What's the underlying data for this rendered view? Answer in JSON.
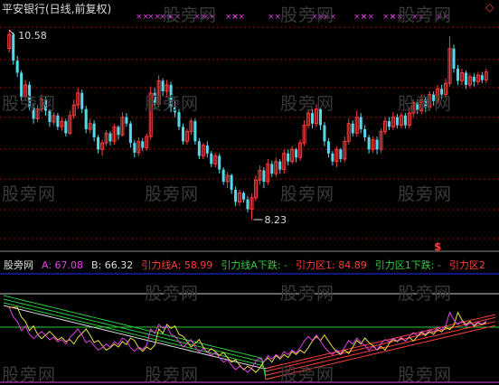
{
  "title": "平安银行(日线,前复权)",
  "colors": {
    "up": "#ff3b3b",
    "down": "#57d7ea",
    "white": "#dddddd",
    "magenta": "#e040e0",
    "green": "#2ecc40",
    "yellow": "#e8e040",
    "blue": "#2030ff",
    "grid": "#a00000"
  },
  "watermark": "股旁网",
  "price_panel": {
    "high_label": "10.58",
    "low_label": "8.23",
    "signal_mark": "$",
    "ylim": [
      7.95,
      10.75
    ]
  },
  "indicator_legend": [
    {
      "text": "股旁网",
      "color": "#dddddd"
    },
    {
      "text": "A: 67.08",
      "color": "#e040e0"
    },
    {
      "text": "B: 66.32",
      "color": "#dddddd"
    },
    {
      "text": "引力线A: 58.99",
      "color": "#ff3b3b"
    },
    {
      "text": "引力线A下跌: -",
      "color": "#2ecc40"
    },
    {
      "text": "引力区1: 84.89",
      "color": "#ff3b3b"
    },
    {
      "text": "引力区1下跌: -",
      "color": "#2ecc40"
    },
    {
      "text": "引力区2",
      "color": "#ff3b3b"
    }
  ],
  "chart_data": {
    "type": "candlestick",
    "title": "平安银行(日线,前复权)",
    "price_annotations": {
      "high": 10.58,
      "low": 8.23
    },
    "candles": [
      [
        10.35,
        10.52,
        10.3,
        10.58
      ],
      [
        10.52,
        10.2,
        10.15,
        10.55
      ],
      [
        10.2,
        10.05,
        10.0,
        10.26
      ],
      [
        10.05,
        9.75,
        9.7,
        10.08
      ],
      [
        9.75,
        9.9,
        9.7,
        9.96
      ],
      [
        9.9,
        9.62,
        9.58,
        9.94
      ],
      [
        9.62,
        9.48,
        9.42,
        9.66
      ],
      [
        9.48,
        9.6,
        9.44,
        9.65
      ],
      [
        9.6,
        9.72,
        9.56,
        9.78
      ],
      [
        9.72,
        9.58,
        9.52,
        9.76
      ],
      [
        9.58,
        9.44,
        9.38,
        9.6
      ],
      [
        9.44,
        9.52,
        9.4,
        9.56
      ],
      [
        9.52,
        9.38,
        9.34,
        9.55
      ],
      [
        9.38,
        9.45,
        9.33,
        9.5
      ],
      [
        9.45,
        9.3,
        9.26,
        9.48
      ],
      [
        9.3,
        9.52,
        9.28,
        9.58
      ],
      [
        9.52,
        9.65,
        9.48,
        9.72
      ],
      [
        9.65,
        9.8,
        9.6,
        9.86
      ],
      [
        9.8,
        9.6,
        9.55,
        9.84
      ],
      [
        9.6,
        9.35,
        9.3,
        9.64
      ],
      [
        9.35,
        9.42,
        9.3,
        9.48
      ],
      [
        9.42,
        9.25,
        9.2,
        9.46
      ],
      [
        9.25,
        9.1,
        9.05,
        9.28
      ],
      [
        9.1,
        9.18,
        9.02,
        9.22
      ],
      [
        9.18,
        9.3,
        9.14,
        9.34
      ],
      [
        9.3,
        9.2,
        9.15,
        9.33
      ],
      [
        9.2,
        9.38,
        9.16,
        9.42
      ],
      [
        9.38,
        9.28,
        9.22,
        9.4
      ],
      [
        9.28,
        9.5,
        9.26,
        9.56
      ],
      [
        9.5,
        9.42,
        9.38,
        9.55
      ],
      [
        9.42,
        9.18,
        9.12,
        9.45
      ],
      [
        9.18,
        9.06,
        9.0,
        9.22
      ],
      [
        9.06,
        9.2,
        9.02,
        9.25
      ],
      [
        9.2,
        9.12,
        9.08,
        9.24
      ],
      [
        9.12,
        9.26,
        9.08,
        9.3
      ],
      [
        9.26,
        9.8,
        9.22,
        9.88
      ],
      [
        9.8,
        9.66,
        9.6,
        9.86
      ],
      [
        9.66,
        9.95,
        9.62,
        10.02
      ],
      [
        9.95,
        9.82,
        9.76,
        9.98
      ],
      [
        9.82,
        9.9,
        9.74,
        9.96
      ],
      [
        9.9,
        9.62,
        9.56,
        9.94
      ],
      [
        9.62,
        9.56,
        9.5,
        9.7
      ],
      [
        9.56,
        9.38,
        9.34,
        9.6
      ],
      [
        9.38,
        9.2,
        9.16,
        9.42
      ],
      [
        9.2,
        9.32,
        9.16,
        9.36
      ],
      [
        9.32,
        9.45,
        9.28,
        9.48
      ],
      [
        9.45,
        9.2,
        9.16,
        9.48
      ],
      [
        9.2,
        9.02,
        8.98,
        9.24
      ],
      [
        9.02,
        9.15,
        8.98,
        9.18
      ],
      [
        9.15,
        9.05,
        9.0,
        9.2
      ],
      [
        9.05,
        8.92,
        8.88,
        9.08
      ],
      [
        8.92,
        9.02,
        8.88,
        9.06
      ],
      [
        9.02,
        8.85,
        8.8,
        9.05
      ],
      [
        8.85,
        8.7,
        8.66,
        8.88
      ],
      [
        8.7,
        8.78,
        8.62,
        8.82
      ],
      [
        8.78,
        8.6,
        8.55,
        8.8
      ],
      [
        8.6,
        8.45,
        8.4,
        8.64
      ],
      [
        8.45,
        8.56,
        8.4,
        8.6
      ],
      [
        8.56,
        8.48,
        8.44,
        8.58
      ],
      [
        8.48,
        8.36,
        8.32,
        8.52
      ],
      [
        8.36,
        8.5,
        8.23,
        8.55
      ],
      [
        8.5,
        8.72,
        8.46,
        8.78
      ],
      [
        8.72,
        8.84,
        8.66,
        8.9
      ],
      [
        8.84,
        8.7,
        8.62,
        8.88
      ],
      [
        8.7,
        8.92,
        8.66,
        8.98
      ],
      [
        8.92,
        8.8,
        8.76,
        8.96
      ],
      [
        8.8,
        8.95,
        8.76,
        9.0
      ],
      [
        8.95,
        8.85,
        8.8,
        8.98
      ],
      [
        8.85,
        9.05,
        8.8,
        9.1
      ],
      [
        9.05,
        8.95,
        8.9,
        9.1
      ],
      [
        8.95,
        9.1,
        8.92,
        9.14
      ],
      [
        9.1,
        9.0,
        8.94,
        9.12
      ],
      [
        9.0,
        9.18,
        8.96,
        9.22
      ],
      [
        9.18,
        9.4,
        9.14,
        9.46
      ],
      [
        9.4,
        9.55,
        9.36,
        9.6
      ],
      [
        9.55,
        9.42,
        9.36,
        9.6
      ],
      [
        9.42,
        9.6,
        9.38,
        9.66
      ],
      [
        9.6,
        9.4,
        9.34,
        9.62
      ],
      [
        9.4,
        9.2,
        9.14,
        9.44
      ],
      [
        9.2,
        9.05,
        9.0,
        9.24
      ],
      [
        9.05,
        8.95,
        8.9,
        9.08
      ],
      [
        8.95,
        9.1,
        8.88,
        9.14
      ],
      [
        9.1,
        8.98,
        8.94,
        9.12
      ],
      [
        8.98,
        9.2,
        8.94,
        9.26
      ],
      [
        9.2,
        9.42,
        9.16,
        9.48
      ],
      [
        9.42,
        9.3,
        9.26,
        9.46
      ],
      [
        9.3,
        9.5,
        9.26,
        9.58
      ],
      [
        9.5,
        9.35,
        9.3,
        9.55
      ],
      [
        9.35,
        9.25,
        9.2,
        9.4
      ],
      [
        9.25,
        9.1,
        9.05,
        9.28
      ],
      [
        9.1,
        9.22,
        9.06,
        9.26
      ],
      [
        9.22,
        9.1,
        9.04,
        9.26
      ],
      [
        9.1,
        9.32,
        9.06,
        9.36
      ],
      [
        9.32,
        9.45,
        9.28,
        9.5
      ],
      [
        9.45,
        9.38,
        9.34,
        9.5
      ],
      [
        9.38,
        9.5,
        9.34,
        9.56
      ],
      [
        9.5,
        9.4,
        9.36,
        9.54
      ],
      [
        9.4,
        9.52,
        9.36,
        9.56
      ],
      [
        9.52,
        9.4,
        9.36,
        9.55
      ],
      [
        9.4,
        9.55,
        9.36,
        9.6
      ],
      [
        9.55,
        9.68,
        9.5,
        9.72
      ],
      [
        9.68,
        9.58,
        9.54,
        9.72
      ],
      [
        9.58,
        9.72,
        9.54,
        9.78
      ],
      [
        9.72,
        9.62,
        9.56,
        9.75
      ],
      [
        9.62,
        9.78,
        9.58,
        9.82
      ],
      [
        9.78,
        9.7,
        9.64,
        9.82
      ],
      [
        9.7,
        9.85,
        9.66,
        9.9
      ],
      [
        9.85,
        9.78,
        9.72,
        9.9
      ],
      [
        9.78,
        9.92,
        9.74,
        9.98
      ],
      [
        9.92,
        10.35,
        9.88,
        10.5
      ],
      [
        10.35,
        10.1,
        10.05,
        10.4
      ],
      [
        10.1,
        9.95,
        9.9,
        10.15
      ],
      [
        9.95,
        10.05,
        9.9,
        10.1
      ],
      [
        10.05,
        9.9,
        9.85,
        10.08
      ],
      [
        9.9,
        10.0,
        9.86,
        10.04
      ],
      [
        10.0,
        9.94,
        9.88,
        10.04
      ],
      [
        9.94,
        10.02,
        9.9,
        10.06
      ],
      [
        10.02,
        9.96,
        9.92,
        10.06
      ],
      [
        9.96,
        10.06,
        9.92,
        10.1
      ]
    ],
    "indicator": {
      "A": 67.08,
      "B": 66.32,
      "引力线A": 58.99,
      "引力区1": 84.89
    }
  }
}
